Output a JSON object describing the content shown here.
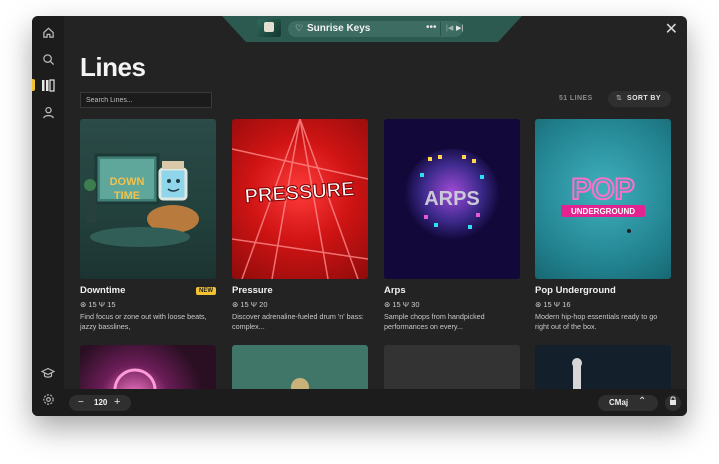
{
  "now_playing": {
    "title": "Sunrise Keys",
    "heart": "♡",
    "more": "•••",
    "prev": "|◀",
    "next": "▶|"
  },
  "page": {
    "title": "Lines"
  },
  "search": {
    "placeholder": "Search Lines..."
  },
  "lines_count": "51 LINES",
  "sort": {
    "label": "SORT BY",
    "icon": "⇅"
  },
  "stats_icons": {
    "keys": "⊛",
    "fork": "Ψ"
  },
  "cards": [
    {
      "title": "Downtime",
      "badge": "NEW",
      "keys": "15",
      "lines": "15",
      "stats": "⊛ 15  Ψ 15",
      "art_text": "DOWN TIME",
      "desc": "Find focus or zone out with loose beats, jazzy basslines,"
    },
    {
      "title": "Pressure",
      "badge": "",
      "keys": "15",
      "lines": "20",
      "stats": "⊛ 15  Ψ 20",
      "art_text": "PRESSURE",
      "desc": "Discover adrenaline-fueled drum 'n' bass: complex..."
    },
    {
      "title": "Arps",
      "badge": "",
      "keys": "15",
      "lines": "30",
      "stats": "⊛ 15  Ψ 30",
      "art_text": "ARPS",
      "desc": "Sample chops from handpicked performances on every..."
    },
    {
      "title": "Pop Underground",
      "badge": "",
      "keys": "15",
      "lines": "16",
      "stats": "⊛ 15  Ψ 16",
      "art_text": "POP",
      "art_sub": "UNDERGROUND",
      "desc": "Modern hip-hop essentials ready to go right out of the box."
    }
  ],
  "bottom": {
    "tempo_minus": "−",
    "tempo": "120",
    "tempo_plus": "+",
    "key": "CMaj",
    "key_chevron": "⌃",
    "lock": "🔒"
  },
  "icons": [
    "home-icon",
    "search-icon",
    "library-icon",
    "user-icon",
    "graduation-cap-icon",
    "gear-icon",
    "close-icon",
    "heart-icon",
    "lock-icon"
  ],
  "colors": {
    "accent": "#f2c230",
    "now_playing": "#3d6c63",
    "background": "#232323"
  }
}
